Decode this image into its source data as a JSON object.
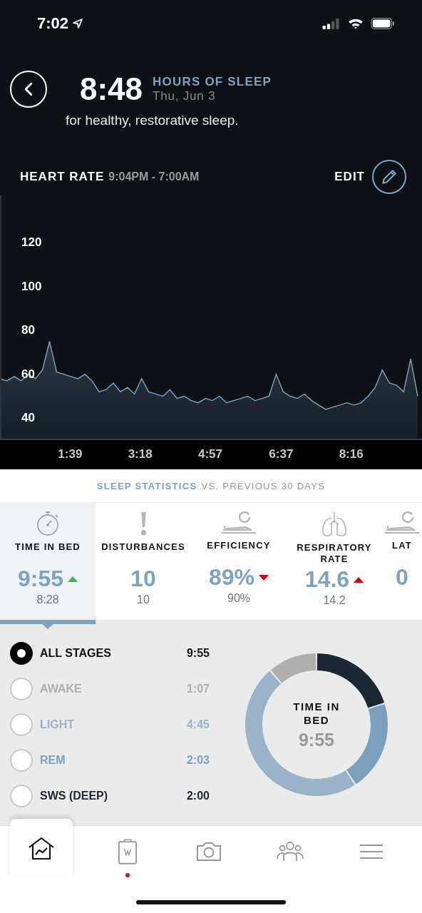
{
  "status_bar": {
    "time": "7:02"
  },
  "header": {
    "value": "8:48",
    "label": "HOURS OF SLEEP",
    "date": "Thu, Jun 3",
    "note": "for healthy, restorative sleep."
  },
  "heart_rate": {
    "title": "HEART RATE",
    "range": "9:04PM - 7:00AM",
    "edit": "EDIT",
    "chart_data": {
      "type": "area",
      "xlim": [
        0,
        596
      ],
      "ylim": [
        30,
        141.5
      ],
      "x": [
        0,
        10,
        20,
        30,
        40,
        50,
        60,
        70,
        80,
        90,
        100,
        110,
        120,
        130,
        140,
        150,
        160,
        170,
        180,
        190,
        200,
        210,
        220,
        230,
        240,
        250,
        260,
        270,
        280,
        290,
        300,
        310,
        320,
        330,
        340,
        350,
        360,
        370,
        380,
        390,
        400,
        410,
        420,
        430,
        440,
        450,
        460,
        470,
        480,
        490,
        500,
        510,
        520,
        530,
        540,
        550,
        560,
        570,
        580,
        590
      ],
      "series": [
        {
          "color": "#7fa3bf",
          "values": [
            58,
            57,
            59,
            57,
            60,
            58,
            62,
            75,
            61,
            60,
            59,
            58,
            60,
            57,
            52,
            53,
            56,
            52,
            54,
            51,
            58,
            52,
            51,
            50,
            53,
            49,
            50,
            48,
            47,
            49,
            48,
            50,
            47,
            48,
            49,
            50,
            48,
            49,
            50,
            60,
            52,
            50,
            49,
            51,
            48,
            46,
            44,
            45,
            46,
            47,
            46,
            47,
            50,
            54,
            62,
            56,
            55,
            52,
            67,
            50
          ]
        }
      ],
      "xticks": [
        {
          "value": 99,
          "label": "1:39"
        },
        {
          "value": 198,
          "label": "3:18"
        },
        {
          "value": 297,
          "label": "4:57"
        },
        {
          "value": 397,
          "label": "6:37"
        },
        {
          "value": 496,
          "label": "8:16"
        }
      ],
      "yticks": [
        40,
        60,
        80,
        100,
        120
      ]
    }
  },
  "statistics": {
    "title": "SLEEP STATISTICS",
    "subtitle": "VS. PREVIOUS 30 DAYS",
    "cards": [
      {
        "kind": "stopwatch",
        "label": "TIME IN BED",
        "value": "9:55",
        "previous": "8:28",
        "trend": {
          "kind": "up",
          "color": "#3fb24a"
        },
        "selected": true
      },
      {
        "kind": "exclamation",
        "label": "DISTURBANCES",
        "value": "10",
        "previous": "10",
        "selected": false
      },
      {
        "kind": "sleeper",
        "label": "EFFICIENCY",
        "value": "89%",
        "previous": "90%",
        "trend": {
          "kind": "down",
          "color": "#d0021b"
        },
        "selected": false
      },
      {
        "kind": "lungs",
        "label": "RESPIRATORY RATE",
        "value": "14.6",
        "previous": "14.2",
        "trend": {
          "kind": "up",
          "color": "#d0021b"
        },
        "selected": false
      },
      {
        "kind": "sleeper",
        "label": "LAT",
        "value": "0",
        "selected": false
      }
    ]
  },
  "stages": {
    "items": [
      {
        "label": "ALL STAGES",
        "time": "9:55",
        "color": "#111111",
        "selected": true
      },
      {
        "label": "AWAKE",
        "time": "1:07",
        "color": "#b0b0b0",
        "selected": false
      },
      {
        "label": "LIGHT",
        "time": "4:45",
        "color": "#9ab3c9",
        "selected": false
      },
      {
        "label": "REM",
        "time": "2:03",
        "color": "#7aa0bd",
        "selected": false
      },
      {
        "label": "SWS (DEEP)",
        "time": "2:00",
        "color": "#1c2733",
        "selected": false
      }
    ],
    "donut": {
      "title": "TIME IN BED",
      "value": "9:55"
    }
  },
  "tab_bar": [
    {
      "kind": "home",
      "selected": true,
      "badge": false
    },
    {
      "kind": "clipboard",
      "selected": false,
      "badge": true
    },
    {
      "kind": "camera",
      "selected": false,
      "badge": false
    },
    {
      "kind": "people",
      "selected": false,
      "badge": false
    },
    {
      "kind": "menu",
      "selected": false,
      "badge": false
    }
  ]
}
